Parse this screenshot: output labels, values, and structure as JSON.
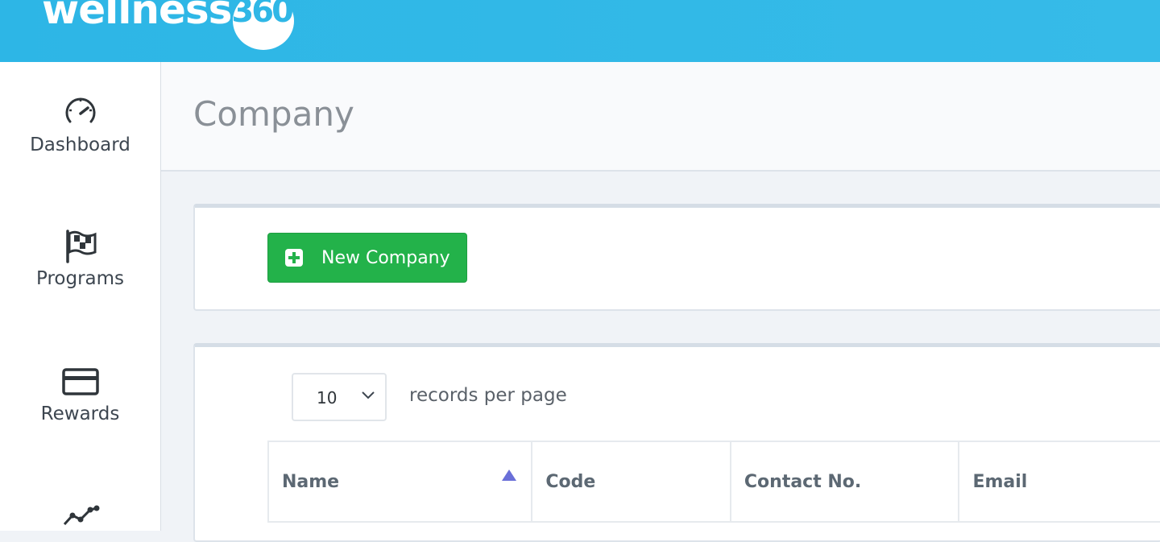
{
  "header": {
    "logo_text": "wellness",
    "logo_number": "360",
    "brand_color": "#2db6e6"
  },
  "sidebar": {
    "items": [
      {
        "label": "Dashboard",
        "icon": "speedometer-icon"
      },
      {
        "label": "Programs",
        "icon": "flag-icon"
      },
      {
        "label": "Rewards",
        "icon": "credit-card-icon"
      },
      {
        "label": "",
        "icon": "chart-line-icon"
      }
    ]
  },
  "page": {
    "title": "Company"
  },
  "actions": {
    "new_company_label": "New Company",
    "button_color": "#23b24a"
  },
  "table": {
    "page_size": "10",
    "records_per_page_label": "records per page",
    "columns": [
      "Name",
      "Code",
      "Contact No.",
      "Email"
    ],
    "sorted_column": "Name",
    "sort_direction": "ascending"
  }
}
